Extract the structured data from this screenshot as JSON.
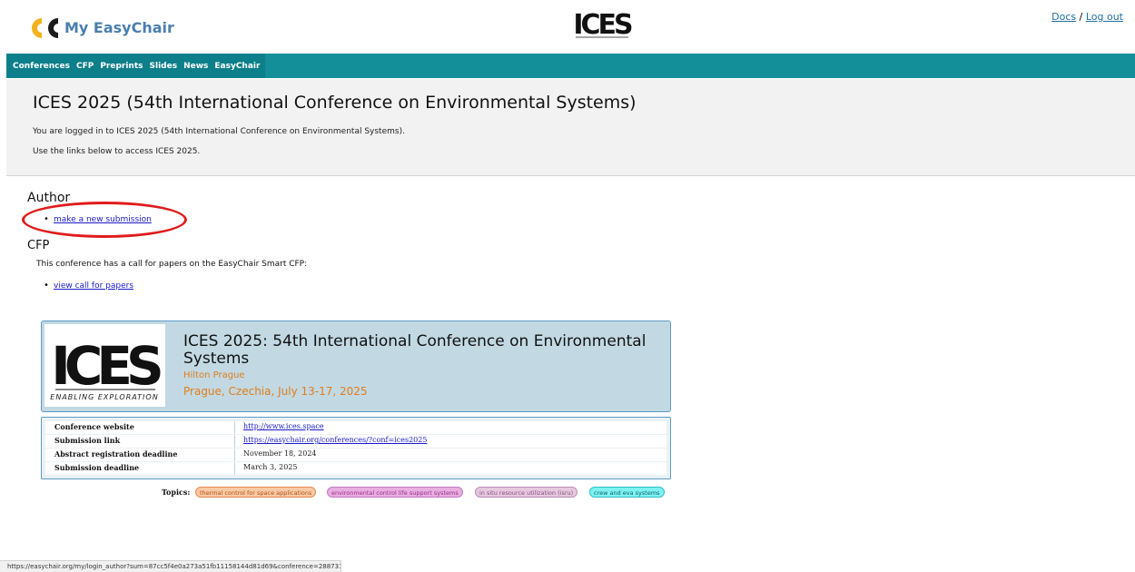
{
  "app": {
    "logo_text": "My EasyChair"
  },
  "top_links": {
    "docs": "Docs",
    "separator": "/",
    "logout": "Log out"
  },
  "nav": {
    "tabs": [
      "Conferences",
      "CFP",
      "Preprints",
      "Slides",
      "News",
      "EasyChair"
    ]
  },
  "header": {
    "title": "ICES 2025 (54th International Conference on Environmental Systems)",
    "line1": "You are logged in to ICES 2025 (54th International Conference on Environmental Systems).",
    "line2": "Use the links below to access ICES 2025."
  },
  "author_section": {
    "heading": "Author",
    "link": "make a new submission"
  },
  "cfp_section": {
    "heading": "CFP",
    "text": "This conference has a call for papers on the EasyChair Smart CFP:",
    "link": "view call for papers"
  },
  "card": {
    "logo_caption": "ENABLING EXPLORATION",
    "title": "ICES 2025: 54th International Conference on Environmental Systems",
    "venue": "Hilton Prague",
    "location": "Prague, Czechia, July 13-17, 2025"
  },
  "info_table": {
    "rows": [
      {
        "label": "Conference website",
        "value": "http://www.ices.space"
      },
      {
        "label": "Submission link",
        "value": "https://easychair.org/conferences/?conf=ices2025"
      },
      {
        "label": "Abstract registration deadline",
        "value": "November 18, 2024"
      },
      {
        "label": "Submission deadline",
        "value": "March 3, 2025"
      }
    ]
  },
  "topics": {
    "label": "Topics:",
    "items": [
      {
        "text": "thermal control for space applications",
        "bg": "#f9c9a5",
        "border": "#e88b4e",
        "color": "#b24e12"
      },
      {
        "text": "environmental control life support systems",
        "bg": "#e8aee0",
        "border": "#c37ac3",
        "color": "#9a2c8c"
      },
      {
        "text": "in situ resource utilization (isru)",
        "bg": "#e6c8df",
        "border": "#b98eb4",
        "color": "#8a4f82"
      },
      {
        "text": "crew and eva systems",
        "bg": "#7ef2f2",
        "border": "#2fbfc8",
        "color": "#0d5d6a"
      }
    ]
  },
  "status_url": "https://easychair.org/my/login_author?sum=87cc5f4e0a273a51fb11158144d81d69&conference=288731"
}
